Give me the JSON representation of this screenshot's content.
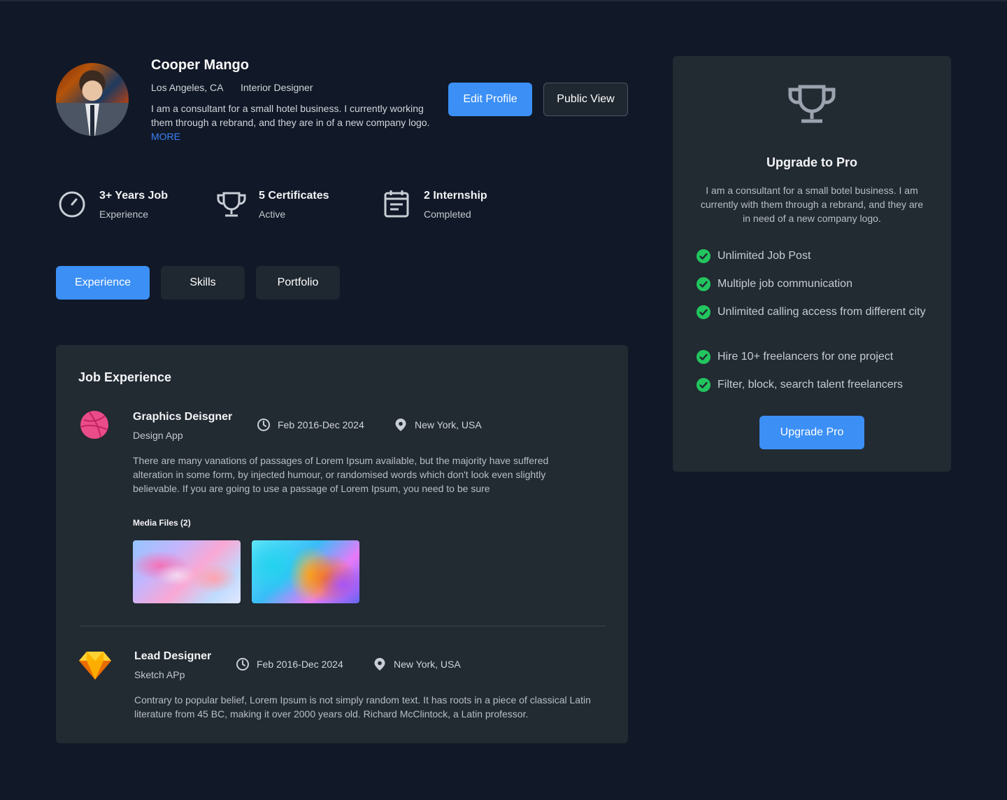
{
  "profile": {
    "name": "Cooper Mango",
    "location": "Los Angeles, CA",
    "role": "Interior Designer",
    "bio": "I am a consultant for a small hotel business. I currently working them through a rebrand, and they are in of a new company logo.",
    "more_link": "MORE"
  },
  "actions": {
    "edit_profile": "Edit Profile",
    "public_view": "Public View"
  },
  "stats": [
    {
      "title": "3+ Years Job",
      "subtitle": "Experience",
      "icon": "stopwatch-icon"
    },
    {
      "title": "5 Certificates",
      "subtitle": "Active",
      "icon": "trophy-icon"
    },
    {
      "title": "2 Internship",
      "subtitle": "Completed",
      "icon": "calendar-icon"
    }
  ],
  "tabs": [
    {
      "label": "Experience",
      "active": true
    },
    {
      "label": "Skills",
      "active": false
    },
    {
      "label": "Portfolio",
      "active": false
    }
  ],
  "experience": {
    "title": "Job Experience",
    "jobs": [
      {
        "title": "Graphics Deisgner",
        "company": "Design App",
        "dates": "Feb 2016-Dec 2024",
        "location": "New York, USA",
        "icon": "dribbble-icon",
        "description": "There are many vanations of passages of Lorem Ipsum available, but the majority have suffered alteration in some form, by injected humour, or randomised words which don't look even slightly believable. If you are going to use a passage of Lorem Ipsum, you need to be sure",
        "media_label": "Media Files (2)"
      },
      {
        "title": "Lead Designer",
        "company": "Sketch APp",
        "dates": "Feb 2016-Dec 2024",
        "location": "New York, USA",
        "icon": "sketch-icon",
        "description": "Contrary to popular belief, Lorem Ipsum is not simply random text. It has roots in a piece of classical Latin literature from 45 BC, making it over 2000 years old. Richard McClintock, a Latin professor."
      }
    ]
  },
  "upgrade": {
    "icon": "trophy-icon",
    "title": "Upgrade to Pro",
    "description": "I am a consultant for a small botel business. I am currently with them through a rebrand, and they are in need of a new company logo.",
    "features": [
      "Unlimited Job Post",
      "Multiple job communication",
      "Unlimited calling access from different city",
      "Hire 10+ freelancers for one project",
      "Filter, block, search talent freelancers"
    ],
    "button": "Upgrade Pro"
  },
  "colors": {
    "background": "#111827",
    "card": "#222a32",
    "accent": "#3b8ff5",
    "check": "#22c55e",
    "dribbble": "#ea4c89",
    "sketch": "#fdb300"
  }
}
